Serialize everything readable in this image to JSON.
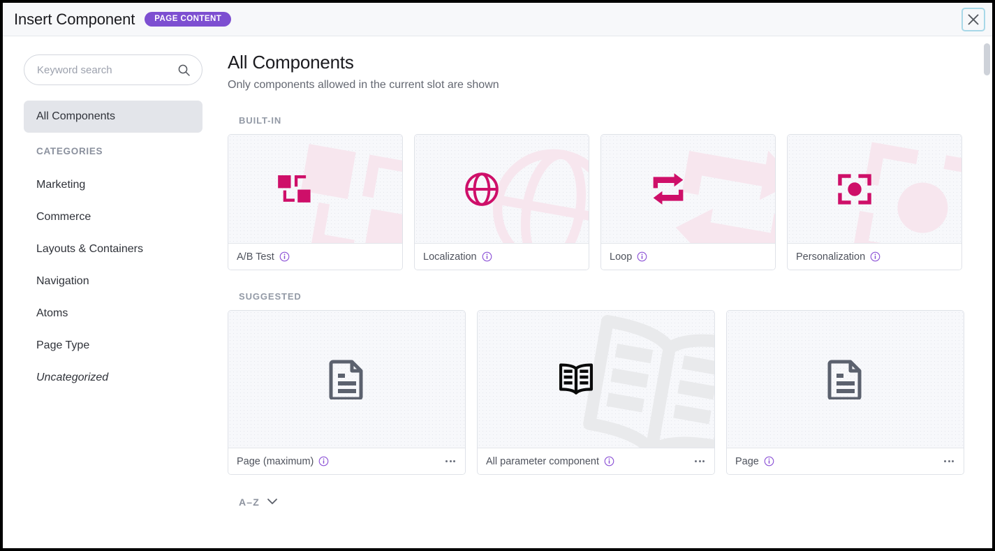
{
  "header": {
    "title": "Insert Component",
    "badge": "PAGE CONTENT",
    "close_label": "Close"
  },
  "sidebar": {
    "search": {
      "placeholder": "Keyword search",
      "value": ""
    },
    "all_components_label": "All Components",
    "categories_heading": "CATEGORIES",
    "categories": [
      {
        "label": "Marketing"
      },
      {
        "label": "Commerce"
      },
      {
        "label": "Layouts & Containers"
      },
      {
        "label": "Navigation"
      },
      {
        "label": "Atoms"
      },
      {
        "label": "Page Type"
      },
      {
        "label": "Uncategorized"
      }
    ]
  },
  "main": {
    "title": "All Components",
    "subtitle": "Only components allowed in the current slot are shown",
    "builtin_label": "BUILT-IN",
    "suggested_label": "SUGGESTED",
    "builtin": [
      {
        "label": "A/B Test",
        "icon": "ab-test-icon"
      },
      {
        "label": "Localization",
        "icon": "globe-icon"
      },
      {
        "label": "Loop",
        "icon": "loop-icon"
      },
      {
        "label": "Personalization",
        "icon": "target-icon"
      }
    ],
    "suggested": [
      {
        "label": "Page (maximum)",
        "icon": "document-icon"
      },
      {
        "label": "All parameter component",
        "icon": "book-icon"
      },
      {
        "label": "Page",
        "icon": "document-icon"
      }
    ],
    "sort": {
      "label": "A–Z",
      "chevron": "chevron-down-icon"
    }
  },
  "colors": {
    "accent_magenta": "#CE0F69",
    "accent_purple": "#7D4FD1",
    "info_purple": "#8C52D6",
    "doc_gray": "#5B616E",
    "card_bg": "#F7F8FB",
    "header_bg": "#F7F8FA"
  }
}
